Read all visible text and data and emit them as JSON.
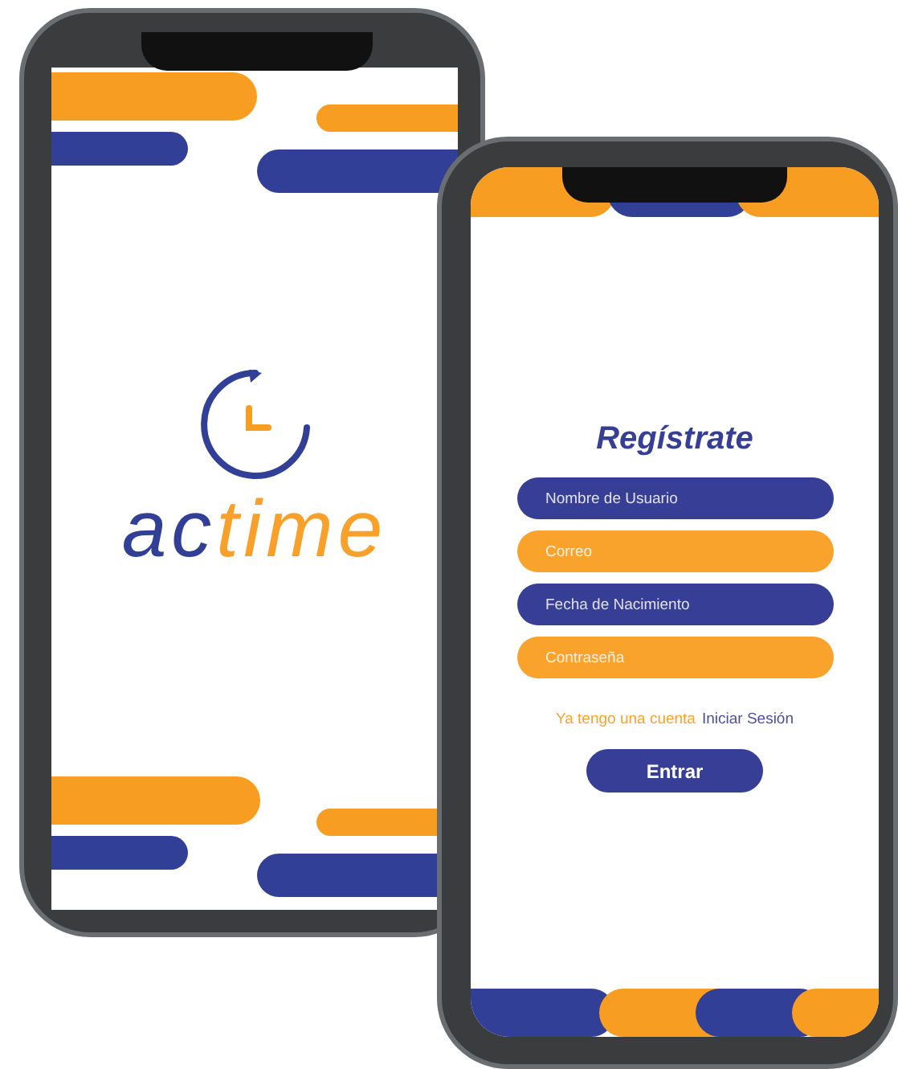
{
  "splash_screen": {
    "logo_text": [
      {
        "text": "ac",
        "color": "#323f96"
      },
      {
        "text": "time",
        "color": "#f8a02a"
      }
    ]
  },
  "register_screen": {
    "title": "Regístrate",
    "fields": [
      {
        "placeholder": "Nombre de Usuario",
        "color": "#363e96"
      },
      {
        "placeholder": "Correo",
        "color": "#f9a22c"
      },
      {
        "placeholder": "Fecha de Nacimiento",
        "color": "#363e96"
      },
      {
        "placeholder": "Contraseña",
        "color": "#f9a22c"
      }
    ],
    "prompt": "Ya tengo una cuenta",
    "login_link": "Iniciar Sesión",
    "submit_button": "Entrar"
  }
}
